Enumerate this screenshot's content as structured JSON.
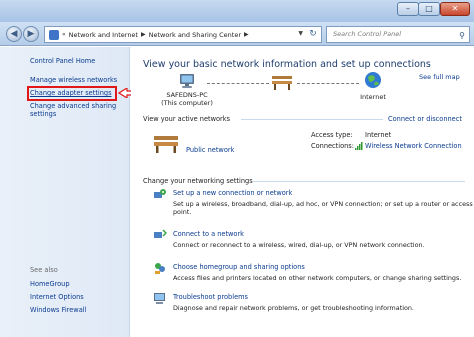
{
  "window": {
    "minimize_glyph": "–",
    "maximize_glyph": "□",
    "close_glyph": "✕"
  },
  "navigation": {
    "back_glyph": "◀",
    "forward_glyph": "▶",
    "breadcrumb": [
      "Network and Internet",
      "Network and Sharing Center"
    ],
    "breadcrumb_prefix": "«",
    "separator": "▶",
    "dropdown_glyph": "▼",
    "refresh_glyph": "↻",
    "search_placeholder": "Search Control Panel",
    "search_glyph": "⚲"
  },
  "sidebar": {
    "home": "Control Panel Home",
    "items": [
      "Manage wireless networks",
      "Change adapter settings",
      "Change advanced sharing",
      "settings"
    ],
    "see_also_heading": "See also",
    "see_also": [
      "HomeGroup",
      "Internet Options",
      "Windows Firewall"
    ]
  },
  "main": {
    "title": "View your basic network information and set up connections",
    "see_full_map": "See full map",
    "map": {
      "computer_name": "SAFEDNS-PC",
      "computer_caption": "(This computer)",
      "internet_label": "Internet"
    },
    "active_networks": {
      "heading": "View your active networks",
      "connect_link": "Connect or disconnect",
      "network_name": "Public network",
      "access_type_label": "Access type:",
      "access_type_value": "Internet",
      "connections_label": "Connections:",
      "connections_value": "Wireless Network Connection"
    },
    "settings": {
      "heading": "Change your networking settings",
      "tasks": [
        {
          "title": "Set up a new connection or network",
          "desc_line1": "Set up a wireless, broadband, dial-up, ad hoc, or VPN connection; or set up a router or access",
          "desc_line2": "point."
        },
        {
          "title": "Connect to a network",
          "desc_line1": "Connect or reconnect to a wireless, wired, dial-up, or VPN network connection.",
          "desc_line2": ""
        },
        {
          "title": "Choose homegroup and sharing options",
          "desc_line1": "Access files and printers located on other network computers, or change sharing settings.",
          "desc_line2": ""
        },
        {
          "title": "Troubleshoot problems",
          "desc_line1": "Diagnose and repair network problems, or get troubleshooting information.",
          "desc_line2": ""
        }
      ]
    }
  },
  "colors": {
    "link": "#0b3c8f",
    "highlight": "#e01818",
    "sidebar_bg": "#e3ecf7"
  }
}
